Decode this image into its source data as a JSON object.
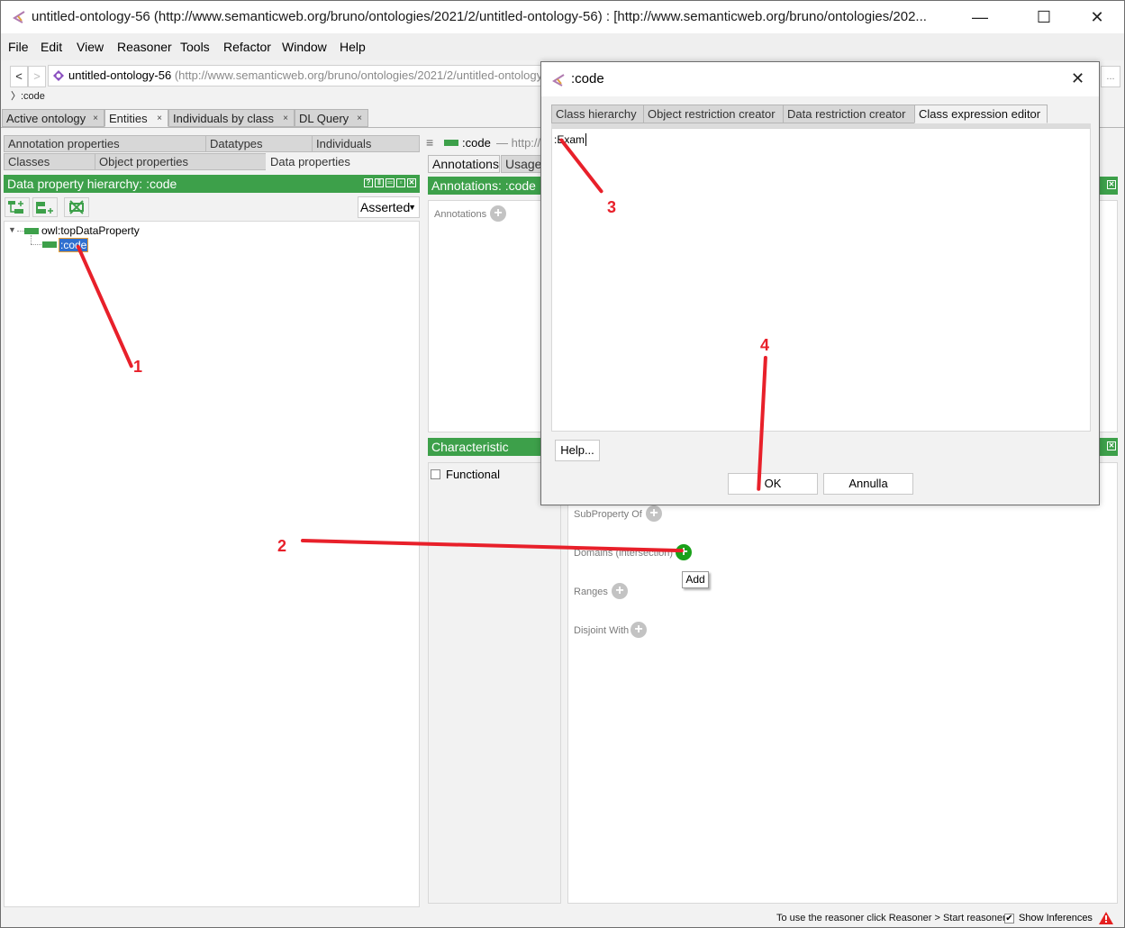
{
  "window": {
    "title": "untitled-ontology-56 (http://www.semanticweb.org/bruno/ontologies/2021/2/untitled-ontology-56)  : [http://www.semanticweb.org/bruno/ontologies/202...",
    "minimize_icon": "—",
    "maximize_icon": "☐",
    "close_icon": "✕"
  },
  "menu": [
    "File",
    "Edit",
    "View",
    "Reasoner",
    "Tools",
    "Refactor",
    "Window",
    "Help"
  ],
  "nav": {
    "back": "<",
    "forward": ">",
    "ontology_name": "untitled-ontology-56",
    "ontology_iri": " (http://www.semanticweb.org/bruno/ontologies/2021/2/untitled-ontology",
    "more": "...",
    "breadcrumb": ":code"
  },
  "top_tabs": [
    {
      "label": "Active ontology",
      "close": "×"
    },
    {
      "label": "Entities",
      "close": "×",
      "active": true
    },
    {
      "label": "Individuals by class",
      "close": "×"
    },
    {
      "label": "DL Query",
      "close": "×"
    }
  ],
  "entity_tabs": {
    "row1": [
      "Annotation properties",
      "Datatypes",
      "Individuals"
    ],
    "row2": [
      "Classes",
      "Object properties",
      "Data properties"
    ],
    "active": "Data properties"
  },
  "hierarchy": {
    "title": "Data property hierarchy: :code",
    "view_mode": "Asserted",
    "root": "owl:topDataProperty",
    "child": ":code"
  },
  "entity_header": {
    "name": ":code",
    "iri": "— http://"
  },
  "annotations": {
    "tabs": [
      "Annotations",
      "Usage"
    ],
    "title": "Annotations: :code",
    "label": "Annotations"
  },
  "characteristics": {
    "title": "Characteristic",
    "functional_label": "Functional",
    "functional_checked": false
  },
  "description": {
    "subproperty_of": "SubProperty Of",
    "domains": "Domains (intersection)",
    "ranges": "Ranges",
    "disjoint_with": "Disjoint With",
    "tooltip": "Add"
  },
  "dialog": {
    "title": ":code",
    "tabs": [
      "Class hierarchy",
      "Object restriction creator",
      "Data restriction creator",
      "Class expression editor"
    ],
    "active_tab": "Class expression editor",
    "editor_text": ":Exam",
    "help_button": "Help...",
    "ok_button": "OK",
    "cancel_button": "Annulla"
  },
  "annotations_overlay": [
    "1",
    "2",
    "3",
    "4"
  ],
  "status_bar": {
    "message": "To use the reasoner click Reasoner > Start reasoner",
    "show_inferences_label": "Show Inferences",
    "show_inferences_checked": true
  },
  "colors": {
    "accent_green": "#3da04a",
    "add_green": "#1aa11a",
    "selection_blue": "#2f6fcf",
    "annotation_red": "#e8202a"
  }
}
